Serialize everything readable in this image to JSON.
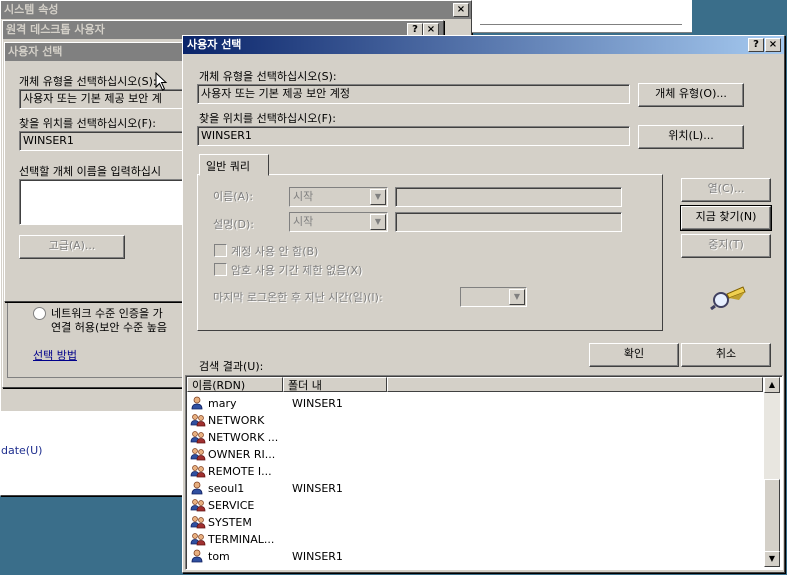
{
  "bg_window": {
    "title": "시스템 속성",
    "right_text": "date(U)",
    "close_glyph": "×"
  },
  "rdu_window": {
    "title": "원격 데스크톱 사용자",
    "help_glyph": "?",
    "close_glyph": "×",
    "radio_label_line1": "네트워크 수준 인증을 가",
    "radio_label_line2": "연결 허용(보안 수준 높음",
    "help_link": "선택 방법"
  },
  "back_select": {
    "title": "사용자 선택",
    "type_label": "개체 유형을 선택하십시오(S):",
    "type_value": "사용자 또는 기본 제공 보안 계",
    "loc_label": "찾을 위치를 선택하십시오(F):",
    "loc_value": "WINSER1",
    "names_label": "선택할 개체 이름을 입력하십시",
    "advanced_button": "고급(A)..."
  },
  "dialog": {
    "title": "사용자 선택",
    "help_glyph": "?",
    "close_glyph": "×",
    "object_type_label": "개체 유형을 선택하십시오(S):",
    "object_type_value": "사용자 또는 기본 제공 보안 계정",
    "object_type_button": "개체 유형(O)...",
    "location_label": "찾을 위치를 선택하십시오(F):",
    "location_value": "WINSER1",
    "location_button": "위치(L)...",
    "tab_label": "일반 쿼리",
    "name_label": "이름(A):",
    "name_combo": "시작",
    "desc_label": "설명(D):",
    "desc_combo": "시작",
    "disabled_accounts": "계정 사용 안 함(B)",
    "nonexpiring_pw": "암호 사용 기간 제한 없음(X)",
    "days_since_logon": "마지막 로그온한 후 지난 시간(일)(I):",
    "columns_button": "열(C)...",
    "find_now_button": "지금 찾기(N)",
    "stop_button": "중지(T)",
    "ok_button": "확인",
    "cancel_button": "취소",
    "results_label": "검색 결과(U):",
    "columns": [
      "이름(RDN)",
      "폴더 내"
    ],
    "results": [
      {
        "name": "mary",
        "folder": "WINSER1",
        "icon": "user-icon"
      },
      {
        "name": "NETWORK",
        "folder": "",
        "icon": "group-icon"
      },
      {
        "name": "NETWORK ...",
        "folder": "",
        "icon": "group-icon"
      },
      {
        "name": "OWNER RI...",
        "folder": "",
        "icon": "group-icon"
      },
      {
        "name": "REMOTE I...",
        "folder": "",
        "icon": "group-icon"
      },
      {
        "name": "seoul1",
        "folder": "WINSER1",
        "icon": "user-icon"
      },
      {
        "name": "SERVICE",
        "folder": "",
        "icon": "group-icon"
      },
      {
        "name": "SYSTEM",
        "folder": "",
        "icon": "group-icon"
      },
      {
        "name": "TERMINAL...",
        "folder": "",
        "icon": "group-icon"
      },
      {
        "name": "tom",
        "folder": "WINSER1",
        "icon": "user-icon"
      }
    ]
  }
}
